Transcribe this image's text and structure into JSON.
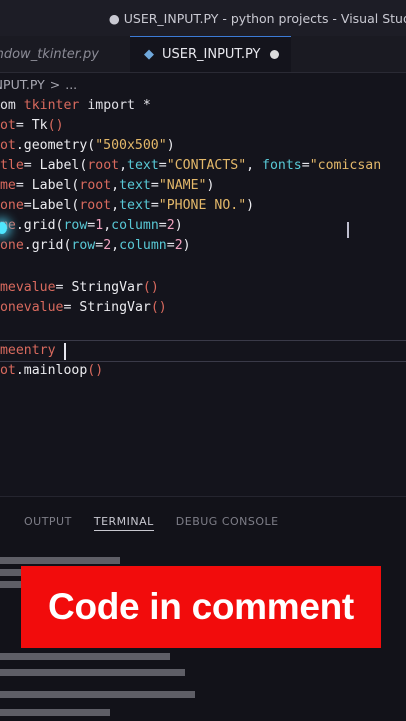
{
  "window": {
    "title": "● USER_INPUT.PY - python projects - Visual Studio Code [U"
  },
  "tabs": [
    {
      "label": "indow_tkinter.py",
      "active": false
    },
    {
      "label": "USER_INPUT.PY",
      "active": true,
      "unsaved": true
    }
  ],
  "breadcrumb": {
    "file": "INPUT.PY",
    "separator": ">",
    "trail": "..."
  },
  "code": {
    "l1": {
      "a": "rom",
      "b": "tkinter",
      "c": "import",
      "d": "*"
    },
    "l2": {
      "a": "oot",
      "b": "=",
      "c": "Tk",
      "d": "()"
    },
    "l3": {
      "a": "oot",
      "b": ".geometry(",
      "c": "\"500x500\"",
      "d": ")"
    },
    "l4": {
      "a": "itle",
      "b": "=",
      "c": "Label(",
      "d": "root",
      "e": ",",
      "f": "text",
      "g": "=",
      "h": "\"CONTACTS\"",
      "i": ", ",
      "j": "fonts",
      "k": "=",
      "l": "\"comicsan"
    },
    "l5": {
      "a": "ame",
      "b": "=",
      "c": "Label(",
      "d": "root",
      "e": ",",
      "f": "text",
      "g": "=",
      "h": "\"NAME\"",
      "i": ")"
    },
    "l6": {
      "a": "hone",
      "b": "=",
      "c": "Label(",
      "d": "root",
      "e": ",",
      "f": "text",
      "g": "=",
      "h": "\"PHONE NO.\"",
      "i": ")"
    },
    "l7": {
      "a": "ame",
      "b": ".grid(",
      "c": "row",
      "d": "=",
      "e": "1",
      "f": ",",
      "g": "column",
      "h": "=",
      "i": "2",
      "j": ")"
    },
    "l8": {
      "a": "hone",
      "b": ".grid(",
      "c": "row",
      "d": "=",
      "e": "2",
      "f": ",",
      "g": "column",
      "h": "=",
      "i": "2",
      "j": ")"
    },
    "l9": {
      "a": "amevalue",
      "b": "=",
      "c": "StringVar",
      "d": "()"
    },
    "l10": {
      "a": "honevalue",
      "b": "=",
      "c": "StringVar",
      "d": "()"
    },
    "l11": {
      "a": "ameentry"
    },
    "l12": {
      "a": "oot",
      "b": ".mainloop",
      "c": "()"
    }
  },
  "panel": {
    "tabs": [
      "OUTPUT",
      "TERMINAL",
      "DEBUG CONSOLE"
    ],
    "active_tab": "TERMINAL"
  },
  "banner": {
    "text": "Code in comment",
    "color": "#f20c0c"
  },
  "colors": {
    "background": "#14141c",
    "variable": "#d96a5e",
    "string": "#e3b86a",
    "parameter": "#59c9d6",
    "number": "#f0a3c0",
    "accent": "#3c7bd6"
  }
}
